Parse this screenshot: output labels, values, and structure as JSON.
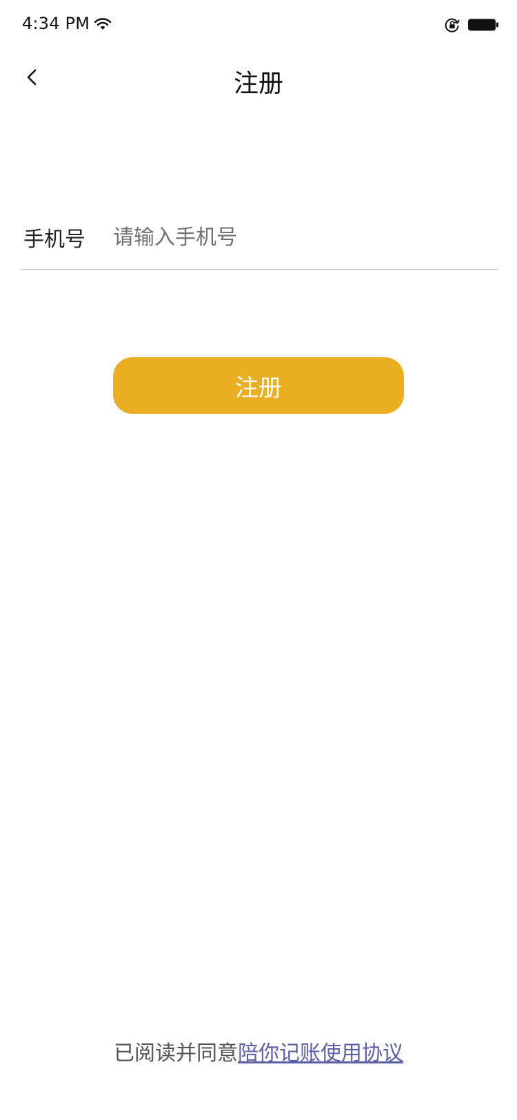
{
  "status_bar": {
    "time": "4:34 PM",
    "icons": [
      "wifi-icon",
      "rotation-lock-icon",
      "battery-icon"
    ]
  },
  "nav": {
    "title": "注册",
    "back_icon": "chevron-left-icon"
  },
  "form": {
    "phone_label": "手机号",
    "phone_placeholder": "请输入手机号",
    "phone_value": ""
  },
  "actions": {
    "register_label": "注册"
  },
  "agreement": {
    "prefix": "已阅读并同意",
    "link_text": "陪你记账使用协议"
  },
  "colors": {
    "accent": "#EAAE22",
    "link": "#5A5FA8",
    "divider": "#B9B9B9"
  }
}
